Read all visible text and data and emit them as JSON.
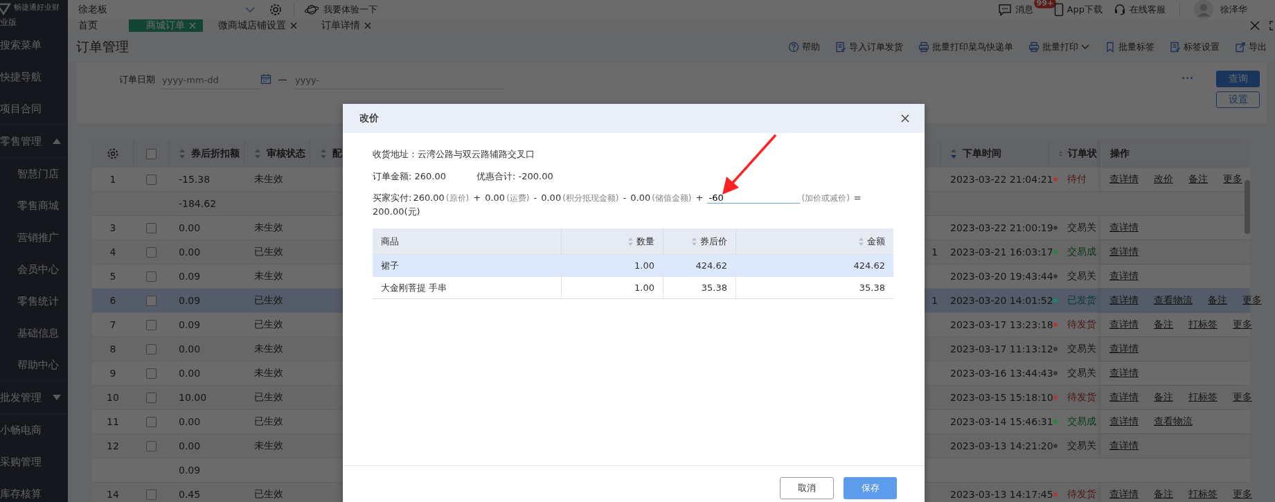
{
  "sidebar": {
    "brand": "畅捷通好业财",
    "edition": "业版",
    "items": [
      {
        "label": "搜索菜单",
        "kind": "link"
      },
      {
        "label": "快捷导航",
        "kind": "link"
      },
      {
        "label": "项目合同",
        "kind": "link"
      },
      {
        "label": "零售管理",
        "kind": "group",
        "expanded": true,
        "children": [
          {
            "label": "智慧门店"
          },
          {
            "label": "零售商城"
          },
          {
            "label": "营销推广"
          },
          {
            "label": "会员中心"
          },
          {
            "label": "零售统计"
          },
          {
            "label": "基础信息"
          },
          {
            "label": "帮助中心"
          }
        ]
      },
      {
        "label": "批发管理",
        "kind": "group",
        "expanded": false
      },
      {
        "label": "小畅电商",
        "kind": "link"
      },
      {
        "label": "采购管理",
        "kind": "link"
      },
      {
        "label": "库存核算",
        "kind": "link"
      }
    ]
  },
  "header": {
    "company": "徐老板",
    "trial": "我要体验一下",
    "messages": "消息",
    "badge": "99+",
    "app": "App下载",
    "service": "在线客服",
    "user": "徐泽华"
  },
  "tabs": [
    {
      "label": "首页",
      "closable": false,
      "selected": false
    },
    {
      "label": "商城订单",
      "closable": true,
      "selected": true
    },
    {
      "label": "微商城店铺设置",
      "closable": true,
      "selected": false
    },
    {
      "label": "订单详情",
      "closable": true,
      "selected": false
    }
  ],
  "page": {
    "title": "订单管理",
    "toolbar": [
      {
        "label": "帮助",
        "dropdown": false
      },
      {
        "label": "导入订单发货",
        "dropdown": false
      },
      {
        "label": "批量打印菜鸟快递单",
        "dropdown": false
      },
      {
        "label": "批量打印",
        "dropdown": true
      },
      {
        "label": "批量标签",
        "dropdown": false
      },
      {
        "label": "标签设置",
        "dropdown": false
      },
      {
        "label": "导出",
        "dropdown": false
      }
    ]
  },
  "filter": {
    "label": "订单日期",
    "start_placeholder": "yyyy-mm-dd",
    "end_placeholder": "yyyy-",
    "more": "...",
    "query": "查询",
    "settings": "设置"
  },
  "table": {
    "all_checked": false,
    "columns": [
      {
        "label": "券后折扣额",
        "sortable": true
      },
      {
        "label": "审核状态",
        "sortable": true
      },
      {
        "label": "配",
        "sortable": true
      },
      {
        "label": "下单时间",
        "sortable": true
      },
      {
        "label": "订单状",
        "sortable": true
      },
      {
        "label": "操作",
        "sortable": false
      }
    ],
    "rows": [
      {
        "no": "1",
        "checked": false,
        "discount": "-15.38",
        "audit": "未生效",
        "time": "2023-03-22 21:04:21",
        "status": "待付",
        "color": "#b03a36",
        "actions": [
          "查详情",
          "改价",
          "备注",
          "更多"
        ],
        "selected": false
      },
      {
        "discount": "-184.62",
        "selected": false
      },
      {
        "no": "3",
        "checked": false,
        "discount": "0.00",
        "audit": "未生效",
        "time": "2023-03-22 21:00:19",
        "status": "交易关",
        "color": "#3a3a3a",
        "actions": [
          "查详情"
        ],
        "selected": false
      },
      {
        "no": "4",
        "checked": false,
        "discount": "0.00",
        "audit": "已生效",
        "column_6": "1",
        "time": "2023-03-21 16:03:17",
        "status": "交易成",
        "color": "#1f8a3e",
        "actions": [
          "查详情"
        ],
        "selected": false
      },
      {
        "no": "5",
        "checked": false,
        "discount": "0.09",
        "audit": "未生效",
        "time": "2023-03-20 19:43:44",
        "status": "交易关",
        "color": "#3a3a3a",
        "actions": [
          "查详情"
        ],
        "selected": false
      },
      {
        "no": "6",
        "checked": false,
        "discount": "0.09",
        "audit": "已生效",
        "column_6": "1",
        "time": "2023-03-20 14:01:52",
        "status": "已发货",
        "color": "#17887a",
        "actions": [
          "查详情",
          "查看物流",
          "备注",
          "更多"
        ],
        "selected": true
      },
      {
        "no": "7",
        "checked": false,
        "discount": "0.09",
        "audit": "已生效",
        "time": "2023-03-17 13:23:18",
        "status": "待发货",
        "color": "#b03a36",
        "actions": [
          "查详情",
          "备注",
          "打标签",
          "更多"
        ],
        "selected": false
      },
      {
        "no": "8",
        "checked": false,
        "discount": "0.00",
        "audit": "未生效",
        "time": "2023-03-17 11:13:12",
        "status": "交易关",
        "color": "#3a3a3a",
        "actions": [
          "查详情"
        ],
        "selected": false
      },
      {
        "no": "9",
        "checked": false,
        "discount": "0.00",
        "audit": "未生效",
        "time": "2023-03-16 13:44:43",
        "status": "交易关",
        "color": "#3a3a3a",
        "actions": [
          "查详情"
        ],
        "selected": false
      },
      {
        "no": "10",
        "checked": false,
        "discount": "10.00",
        "audit": "已生效",
        "time": "2023-03-15 15:18:10",
        "status": "待发货",
        "color": "#b03a36",
        "actions": [
          "查详情",
          "备注",
          "打标签",
          "更多"
        ],
        "selected": false
      },
      {
        "no": "11",
        "checked": false,
        "discount": "0.00",
        "audit": "已生效",
        "time": "2023-03-14 15:46:31",
        "status": "交易成",
        "color": "#1f8a3e",
        "actions": [
          "查详情",
          "查看物流"
        ],
        "selected": false
      },
      {
        "no": "12",
        "checked": false,
        "discount": "0.00",
        "audit": "未生效",
        "time": "2023-03-13 14:21:20",
        "status": "交易关",
        "color": "#3a3a3a",
        "actions": [
          "查详情"
        ],
        "selected": false
      },
      {
        "discount": "0.09",
        "selected": false
      },
      {
        "no": "14",
        "checked": false,
        "discount": "0.45",
        "audit": "已生效",
        "time": "2023-03-13 14:17:45",
        "status": "待发货",
        "color": "#b03a36",
        "actions": [
          "查详情",
          "备注",
          "打标签",
          "更多"
        ],
        "selected": false
      }
    ]
  },
  "dialog": {
    "title": "改价",
    "address": "收货地址：云湾公路与双云路辅路交叉口",
    "order_amount": "订单金额: 260.00",
    "discount_total": "优惠合计: -200.00",
    "buyer_paid": {
      "label": "买家实付:",
      "terms": [
        {
          "value": "260.00",
          "note": "(原价)"
        },
        {
          "op": "+",
          "value": "0.00",
          "note": "(运费)"
        },
        {
          "op": "-",
          "value": "0.00",
          "note": "(积分抵现金额)"
        },
        {
          "op": "-",
          "value": "0.00",
          "note": "(储值金额)"
        }
      ],
      "adjust_op": "+",
      "adjust_value": "-60",
      "adjust_note": "(加价或减价)",
      "equals": "=",
      "total": "200.00(元)"
    },
    "items": {
      "columns": [
        {
          "label": "商品",
          "sortable": false
        },
        {
          "label": "数量",
          "sortable": true
        },
        {
          "label": "券后价",
          "sortable": true
        },
        {
          "label": "金额",
          "sortable": true
        }
      ],
      "rows": [
        {
          "cells": [
            "裙子",
            "1.00",
            "424.62",
            "424.62"
          ],
          "selected": true
        },
        {
          "cells": [
            "大金刚菩提 手串",
            "1.00",
            "35.38",
            "35.38"
          ],
          "selected": false
        }
      ]
    },
    "cancel": "取消",
    "save": "保存"
  }
}
